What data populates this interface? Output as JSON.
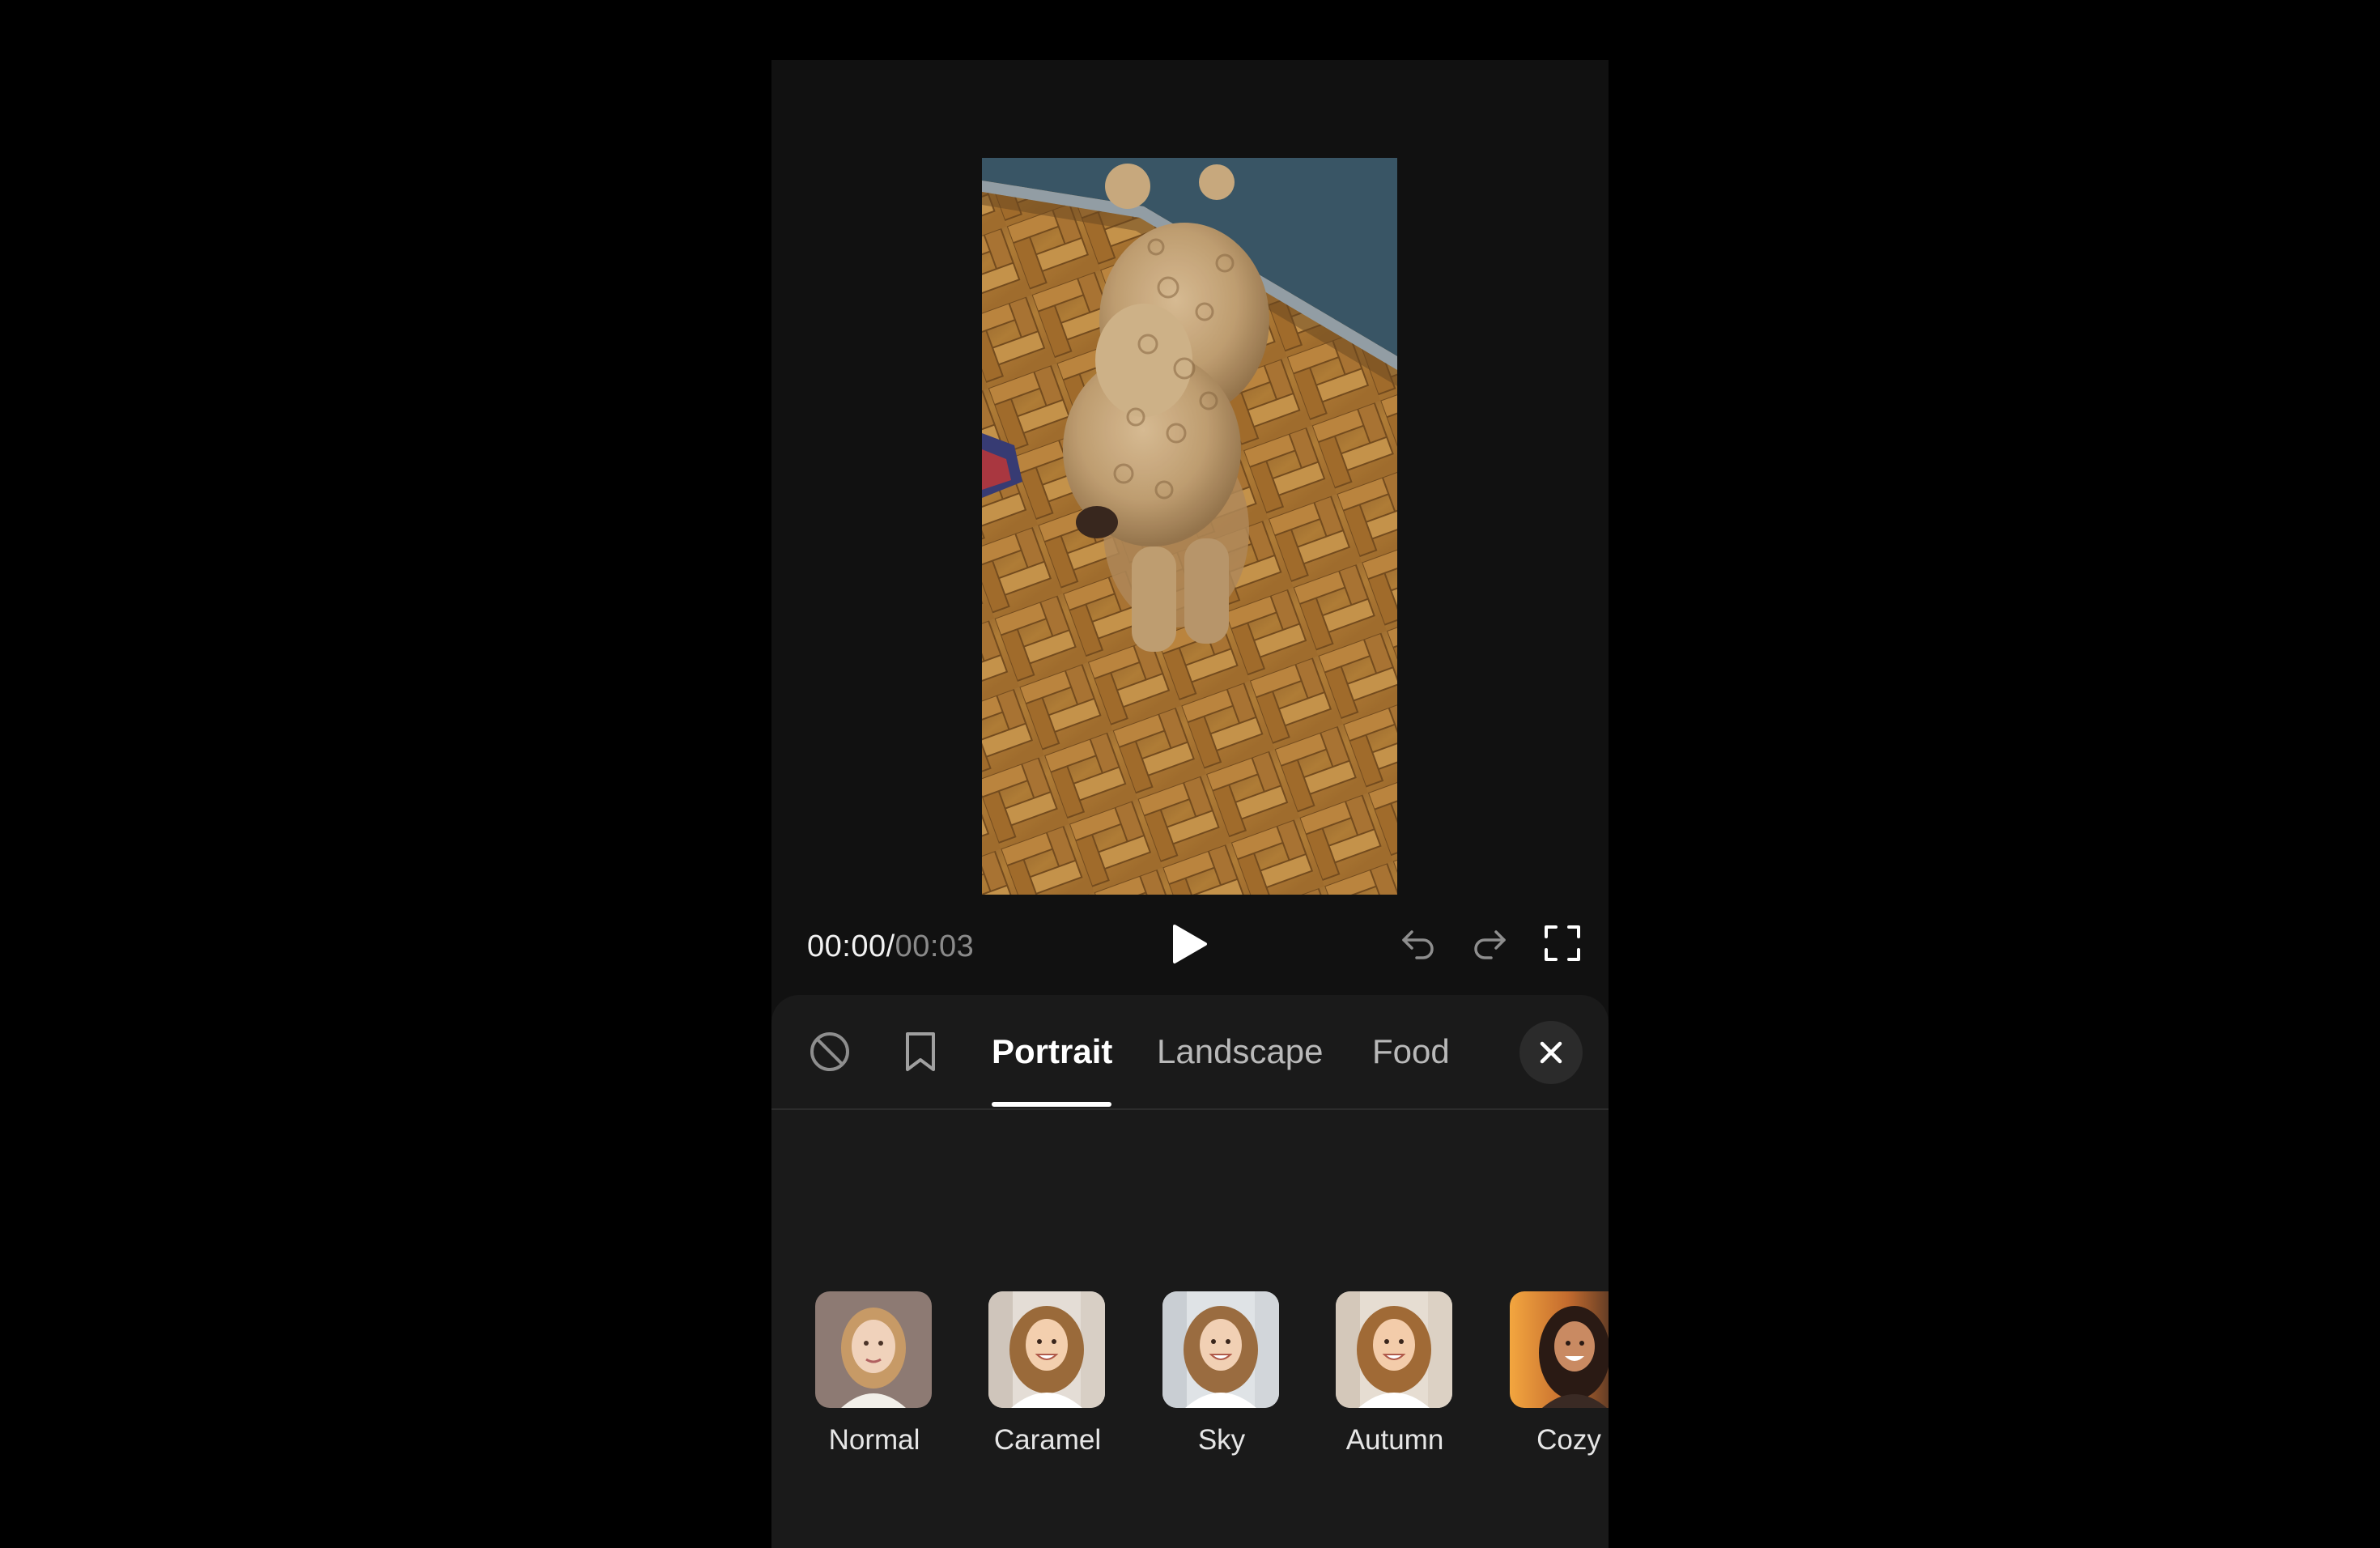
{
  "player": {
    "current_time": "00:00",
    "separator": "/",
    "duration": "00:03"
  },
  "icons": {
    "play": "play-icon",
    "undo": "undo-icon",
    "redo": "redo-icon",
    "fullscreen": "fullscreen-icon",
    "no_filter": "ban-icon",
    "saved": "bookmark-icon",
    "close": "close-icon"
  },
  "filter_panel": {
    "tabs": [
      {
        "label": "Portrait",
        "active": true
      },
      {
        "label": "Landscape",
        "active": false
      },
      {
        "label": "Food",
        "active": false
      }
    ],
    "filters": [
      {
        "label": "Normal"
      },
      {
        "label": "Caramel"
      },
      {
        "label": "Sky"
      },
      {
        "label": "Autumn"
      },
      {
        "label": "Cozy"
      }
    ]
  },
  "colors": {
    "background": "#000000",
    "app_background": "#111111",
    "panel_background": "#1a1a1a",
    "active_tab": "#ffffff",
    "inactive_tab": "#b9b9b9",
    "duration_text": "#8a8a8a"
  }
}
